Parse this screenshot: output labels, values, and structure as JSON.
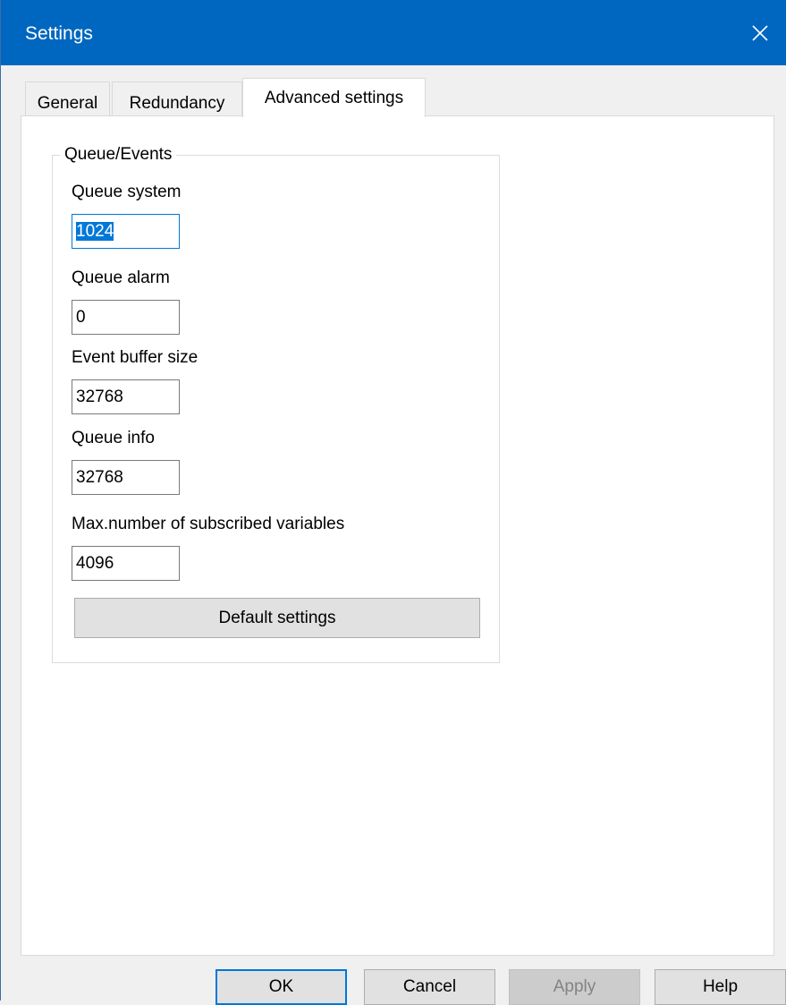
{
  "window": {
    "title": "Settings"
  },
  "tabs": [
    {
      "label": "General"
    },
    {
      "label": "Redundancy"
    },
    {
      "label": "Advanced settings",
      "active": true
    }
  ],
  "group": {
    "title": "Queue/Events",
    "fields": [
      {
        "label": "Queue system",
        "value": "1024"
      },
      {
        "label": "Queue alarm",
        "value": "0"
      },
      {
        "label": "Event buffer size",
        "value": "32768"
      },
      {
        "label": "Queue info",
        "value": "32768"
      },
      {
        "label": "Max.number of subscribed variables",
        "value": "4096"
      }
    ],
    "default_button": "Default settings"
  },
  "buttons": {
    "ok": "OK",
    "cancel": "Cancel",
    "apply": "Apply",
    "help": "Help"
  },
  "colors": {
    "titlebar": "#0067c0",
    "focus": "#0078d7"
  },
  "icons": {
    "close": "close-icon"
  }
}
